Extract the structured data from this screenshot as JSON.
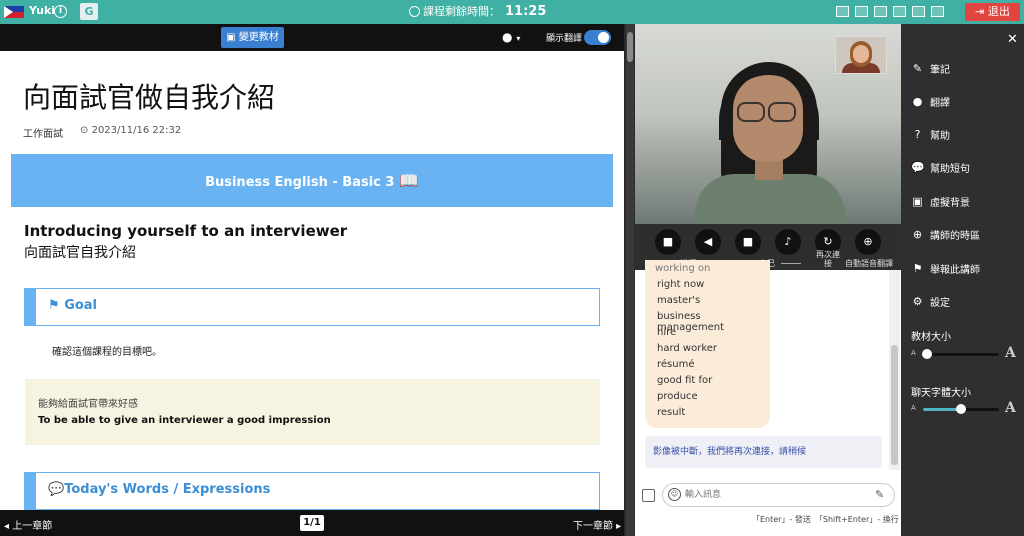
{
  "topbar": {
    "username": "Yuki",
    "info_symbol": "i",
    "timer_label": "課程剩餘時間：",
    "timer_value": "11:25",
    "exit_label": "退出",
    "colors": {
      "bar": "#3fb0a3",
      "exit": "#e2453f"
    }
  },
  "lesson": {
    "change_material": "變更教材",
    "show_translation": "顯示翻譯",
    "translation_on": true,
    "title": "向面試官做自我介紹",
    "category": "工作面試",
    "datetime": "2023/11/16 22:32",
    "banner": "Business English - Basic 3",
    "heading_en": "Introducing yourself to an interviewer",
    "heading_zh": "向面試官自我介紹",
    "goal_label": "Goal",
    "goal_desc": "確認這個課程的目標吧。",
    "goal_zh": "能夠給面試官帶來好感",
    "goal_en": "To be able to give an interviewer a good impression",
    "words_label": "Today's Words / Expressions",
    "prev": "上一章節",
    "page": "1/1",
    "next": "下一章節"
  },
  "video": {
    "controls": {
      "teacher_label": "講師",
      "self_label": "自己",
      "reconnect_label": "再次連接",
      "auto_translate_label": "自動語音翻譯"
    }
  },
  "chat": {
    "vocab": [
      "working on",
      "right now",
      "master's",
      "business management",
      "hire",
      "hard worker",
      "résumé",
      "good fit for",
      "produce",
      "result"
    ],
    "system_message": "影像被中斷，我們將再次連接，請稍候",
    "input_placeholder": "輸入訊息",
    "hint": "「Enter」- 發送　「Shift+Enter」- 換行"
  },
  "menu": {
    "items": [
      {
        "label": "筆記",
        "icon": "note-icon"
      },
      {
        "label": "翻譯",
        "icon": "globe-icon"
      },
      {
        "label": "幫助",
        "icon": "help-icon"
      },
      {
        "label": "幫助短句",
        "icon": "chat-bubble-icon"
      },
      {
        "label": "虛擬背景",
        "icon": "image-icon"
      },
      {
        "label": "講師的時區",
        "icon": "world-icon"
      },
      {
        "label": "舉報此講師",
        "icon": "flag-icon"
      },
      {
        "label": "設定",
        "icon": "gear-icon"
      }
    ],
    "material_size_label": "教材大小",
    "material_size_value": 0.05,
    "chat_font_label": "聊天字體大小",
    "chat_font_value": 0.5
  }
}
